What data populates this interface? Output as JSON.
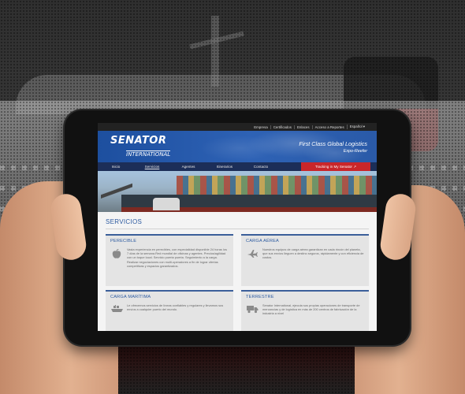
{
  "site": {
    "utility_links": [
      "Empresa",
      "Certificados",
      "Enlaces",
      "Acceso a Reportes"
    ],
    "language": "Español",
    "logo_main": "SENATOR",
    "logo_sub": "INTERNATIONAL",
    "tagline": "First Class Global Logistics",
    "tagline_sub": "Expo-Reefer",
    "nav": [
      {
        "label": "Inicio",
        "active": false
      },
      {
        "label": "Servicios",
        "active": true
      },
      {
        "label": "Agentes",
        "active": false
      },
      {
        "label": "Itinerarios",
        "active": false
      },
      {
        "label": "Contacto",
        "active": false
      }
    ],
    "tracking_label": "Tracking in My Senator",
    "colors": {
      "brand_blue": "#1d4f9f",
      "nav_dark": "#1c2e58",
      "tracking_red": "#c9262a"
    }
  },
  "services": {
    "title": "SERVICIOS",
    "cards": [
      {
        "title": "PERECIBLE",
        "icon": "apple-icon",
        "text": "Vasta experiencia en perecibles, con especialidad disponible 24 horas los 7 días de la semana.Red mundial de oficinas y agentes. Precios/agilidad con un toque local. Servicio puerta puerta. Seguimiento a la carga. Realizar negociaciones con multi-operadores a fin de lograr ofertas competitivas y espacios garantizados."
      },
      {
        "title": "CARGA AÉREA",
        "icon": "airplane-icon",
        "text": "Nuestros equipos de carga aérea garantizan en cada rincón del planeta, que sus envíos lleguen a destino seguros, rápidamente y con eficiencia de costos."
      },
      {
        "title": "CARGA MARÍTIMA",
        "icon": "ship-icon",
        "text": "Le ofrecemos servicios de líneas confiables y regulares y llevamos sus envíos a cualquier puerto del mundo."
      },
      {
        "title": "TERRESTRE",
        "icon": "truck-icon",
        "text": "Senator International, ejecuta sus propias operaciones de transporte de mercancías y de logística en más de 200 centros de fabricación de la industria a nivel"
      }
    ]
  }
}
